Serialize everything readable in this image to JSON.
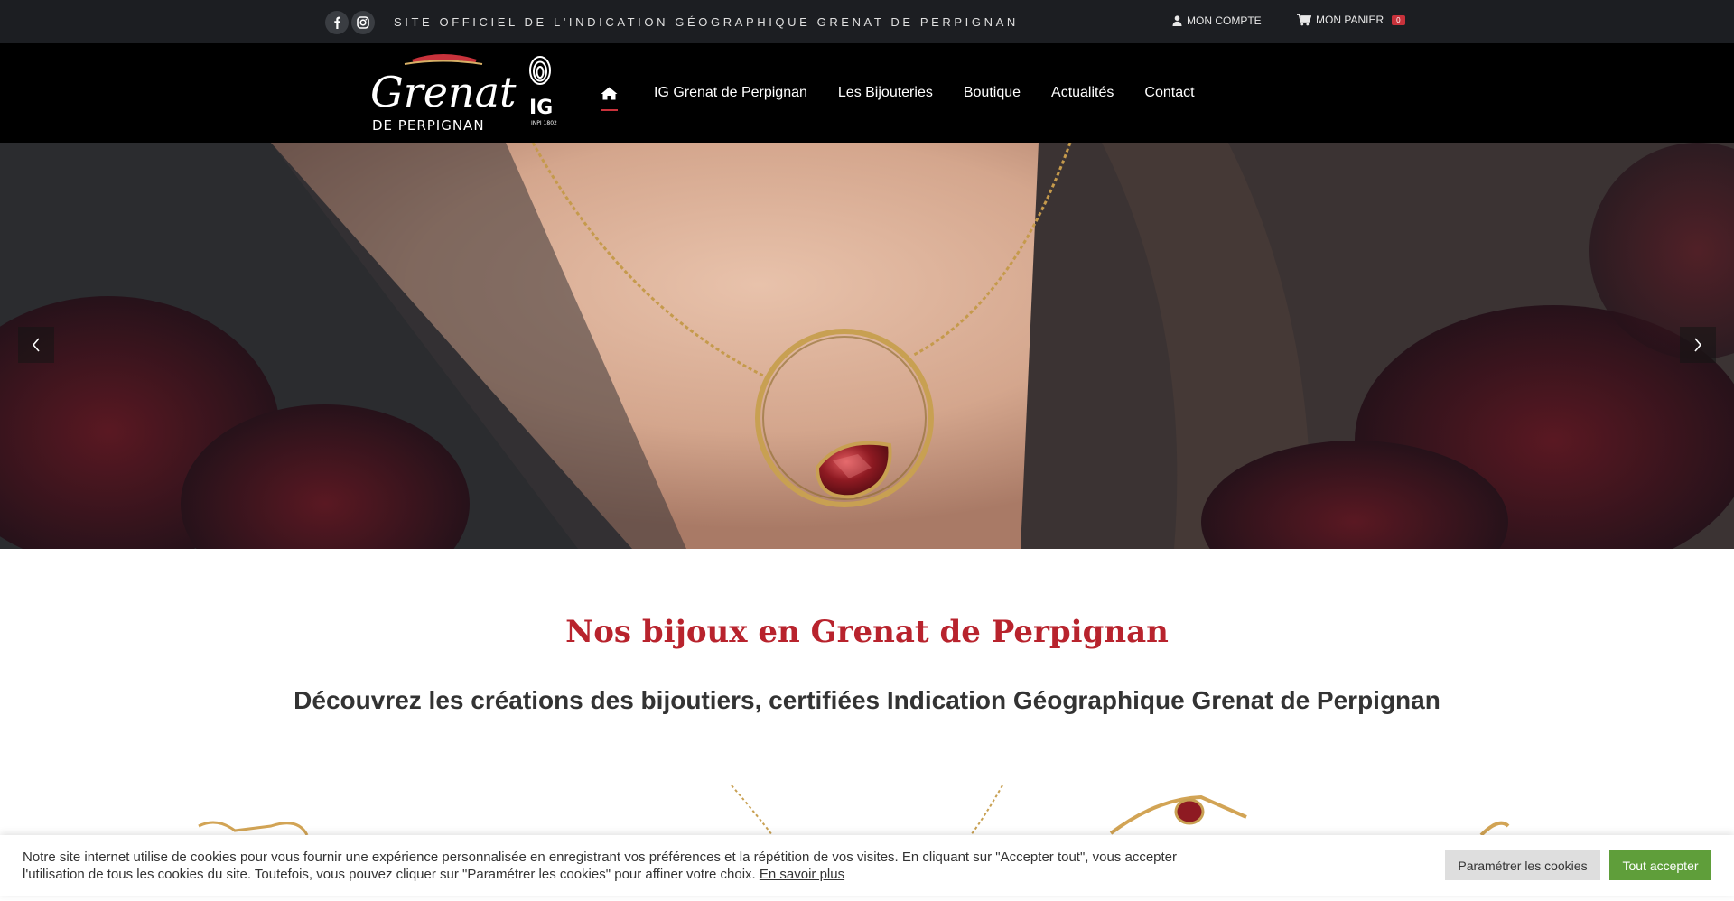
{
  "topbar": {
    "tagline": "SITE OFFICIEL DE L'INDICATION GÉOGRAPHIQUE GRENAT DE PERPIGNAN",
    "account_label": "MON COMPTE",
    "cart_label": "MON PANIER",
    "cart_count": "0",
    "social": [
      "facebook-icon",
      "instagram-icon"
    ]
  },
  "logo": {
    "script": "Grenat",
    "subtitle": "DE PERPIGNAN",
    "ig": "IG",
    "ig_note": "INPI 1802"
  },
  "nav": {
    "home_icon": "home-icon",
    "items": [
      "IG Grenat de Perpignan",
      "Les Bijouteries",
      "Boutique",
      "Actualités",
      "Contact"
    ]
  },
  "main": {
    "title": "Nos bijoux en Grenat de Perpignan",
    "subtitle": "Découvrez les créations des bijoutiers, certifiées Indication Géographique Grenat de Perpignan"
  },
  "cookie": {
    "text": "Notre site internet utilise de cookies pour vous fournir une expérience personnalisée en enregistrant vos préférences et la répétition de vos visites. En cliquant sur \"Accepter tout\", vous accepter l'utilisation de tous les cookies du site. Toutefois, vous pouvez cliquer sur \"Paramétrer les cookies\" pour affiner votre choix.",
    "link": "En savoir plus",
    "settings_button": "Paramétrer les cookies",
    "accept_button": "Tout accepter"
  },
  "colors": {
    "accent": "#c8323b",
    "title": "#b8232d",
    "topbar_bg": "#1c1e22",
    "header_bg": "#000000",
    "accept_bg": "#5f9e3a"
  }
}
